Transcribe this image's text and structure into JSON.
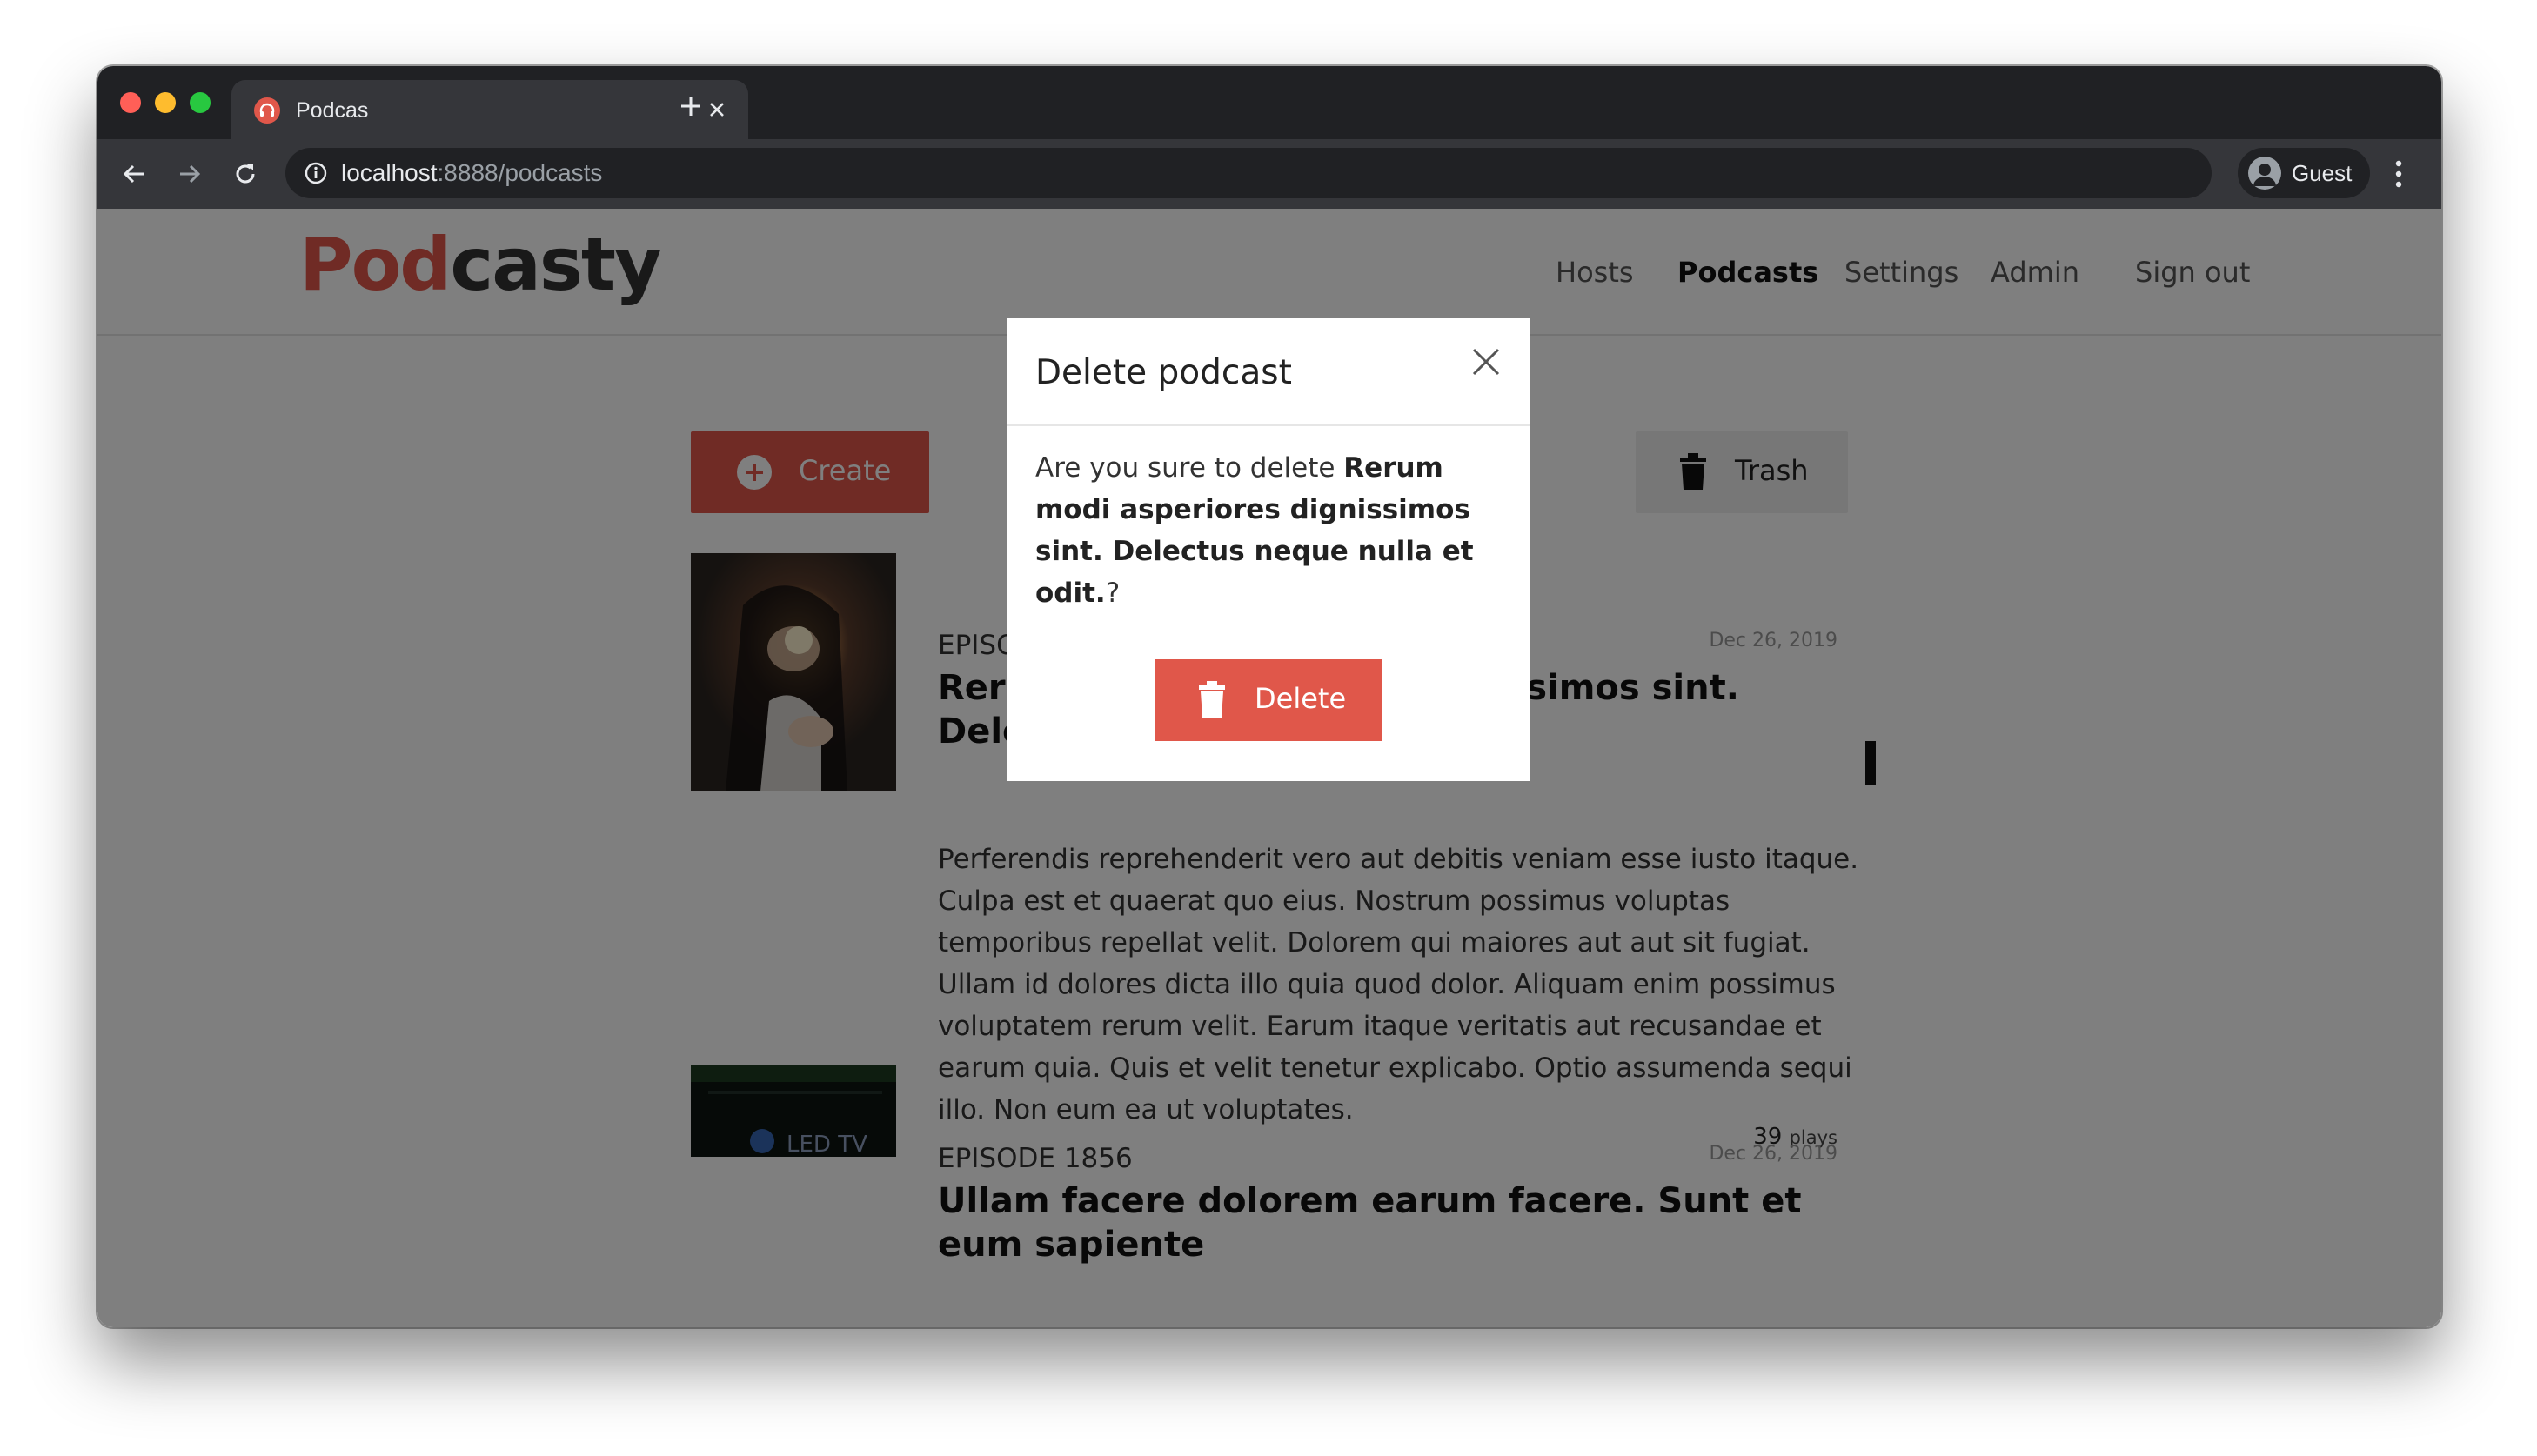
{
  "browser": {
    "tab_title": "Podcas",
    "url_host": "localhost",
    "url_rest": ":8888/podcasts",
    "profile_name": "Guest"
  },
  "site": {
    "logo_part1": "Pod",
    "logo_part2": "casty",
    "nav": [
      "Hosts",
      "Podcasts",
      "Settings",
      "Admin",
      "Sign out"
    ],
    "active_nav": "Podcasts",
    "accent_color": "#e0574a"
  },
  "actions": {
    "create_label": "Create",
    "trash_label": "Trash"
  },
  "episodes": [
    {
      "number": "EPISODE",
      "date": "Dec 26, 2019",
      "title": "Rerum modi asperiores dignissimos sint. Delectus neque nulla et odit.",
      "description": "Perferendis reprehenderit vero aut debitis veniam esse iusto itaque. Culpa est et quaerat quo eius. Nostrum possimus voluptas temporibus repellat velit. Dolorem qui maiores aut aut sit fugiat. Ullam id dolores dicta illo quia quod dolor. Aliquam enim possimus voluptatem rerum velit. Earum itaque veritatis aut recusandae et earum quia. Quis et velit tenetur explicabo. Optio assumenda sequi illo. Non eum ea ut voluptates.",
      "plays": "39",
      "plays_unit": "plays"
    },
    {
      "number": "EPISODE 1856",
      "date": "Dec 26, 2019",
      "title": "Ullam facere dolorem earum facere. Sunt et eum sapiente",
      "thumb_text": "LED TV"
    }
  ],
  "modal": {
    "title": "Delete podcast",
    "prompt_prefix": "Are you sure to delete ",
    "target_name": "Rerum modi asperiores dignissimos sint. Delectus neque nulla et odit.",
    "prompt_suffix": "?",
    "delete_label": "Delete"
  }
}
